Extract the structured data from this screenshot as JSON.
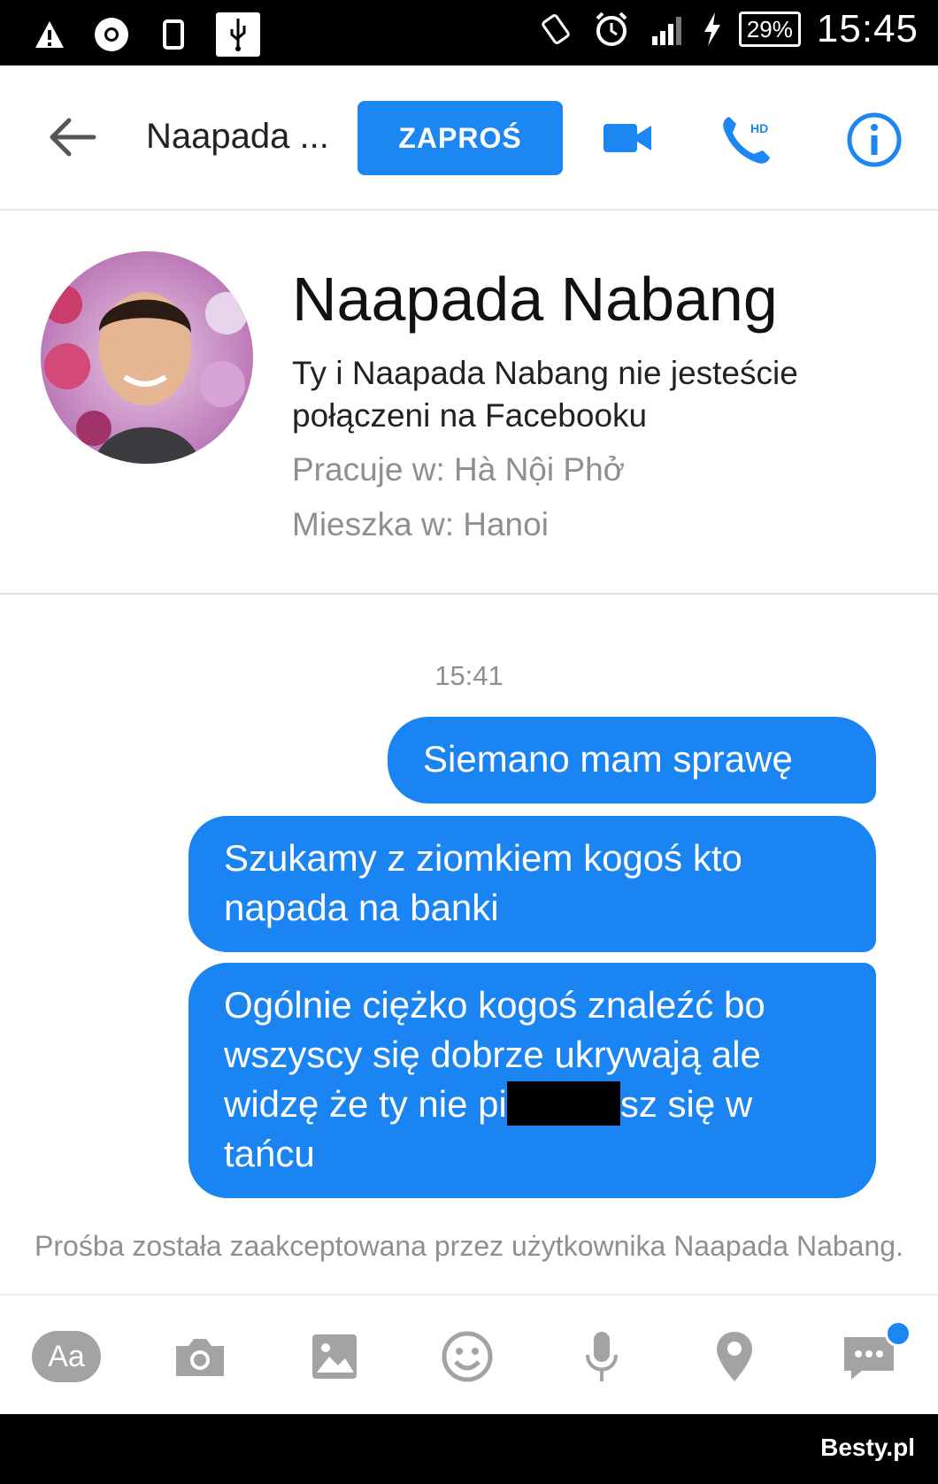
{
  "status_bar": {
    "battery": "29%",
    "time": "15:45",
    "icons": [
      "warning-icon",
      "chrome-icon",
      "phone-icon",
      "usb-icon",
      "vibrate-icon",
      "alarm-icon",
      "signal-icon",
      "charging-icon"
    ]
  },
  "header": {
    "contact_short": "Naapada ...",
    "invite_label": "ZAPROŚ",
    "accent_color": "#1c86f2"
  },
  "profile": {
    "name": "Naapada Nabang",
    "note": "Ty i Naapada Nabang nie jesteście połączeni na Facebooku",
    "works": "Pracuje w: Hà Nội Phở",
    "lives": "Mieszka w: Hanoi"
  },
  "conversation": {
    "timestamp": "15:41",
    "messages": [
      {
        "text": "Siemano mam sprawę"
      },
      {
        "text": "Szukamy z ziomkiem kogoś kto napada na banki"
      },
      {
        "text_before": "Ogólnie ciężko kogoś znaleźć bo wszyscy się dobrze ukrywają ale widzę że ty nie pi",
        "text_after": "sz się w tańcu"
      }
    ],
    "system_message": "Prośba została zaakceptowana przez użytkownika Naapada Nabang."
  },
  "composer": {
    "text_button": "Aa",
    "icons": [
      "camera-icon",
      "image-icon",
      "emoji-icon",
      "microphone-icon",
      "location-icon",
      "more-icon"
    ]
  },
  "watermark": "Besty.pl"
}
